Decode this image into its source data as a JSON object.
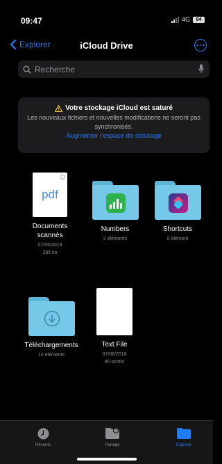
{
  "status_bar": {
    "time": "09:47",
    "network": "4G",
    "battery": "84"
  },
  "nav": {
    "back_label": "Explorer",
    "title": "iCloud Drive"
  },
  "search": {
    "placeholder": "Recherche"
  },
  "alert": {
    "title": "Votre stockage iCloud est saturé",
    "body": "Les nouveaux fichiers et nouvelles modifications ne seront pas synchronisés.",
    "link": "Augmenter l'espace de stockage"
  },
  "items": [
    {
      "name": "Documents scannés",
      "meta1": "07/06/2019",
      "meta2": "285 ko",
      "icon": "pdf-document-icon",
      "icon_text": "pdf"
    },
    {
      "name": "Numbers",
      "meta1": "2 éléments",
      "icon": "numbers-folder-icon"
    },
    {
      "name": "Shortcuts",
      "meta1": "0 élément",
      "icon": "shortcuts-folder-icon"
    },
    {
      "name": "Téléchargements",
      "meta1": "10 éléments",
      "icon": "downloads-folder-icon"
    },
    {
      "name": "Text File",
      "meta1": "07/06/2018",
      "meta2": "80 octets",
      "icon": "text-file-icon"
    }
  ],
  "tabbar": {
    "tabs": [
      {
        "label": "Récents",
        "icon": "clock-icon"
      },
      {
        "label": "Partagé",
        "icon": "shared-folder-icon"
      },
      {
        "label": "Explorer",
        "icon": "folder-icon",
        "active": true
      }
    ]
  },
  "colors": {
    "accent": "#1e7cf6",
    "folder": "#76c8e9",
    "background": "#000000",
    "warning": "#f5c542"
  }
}
